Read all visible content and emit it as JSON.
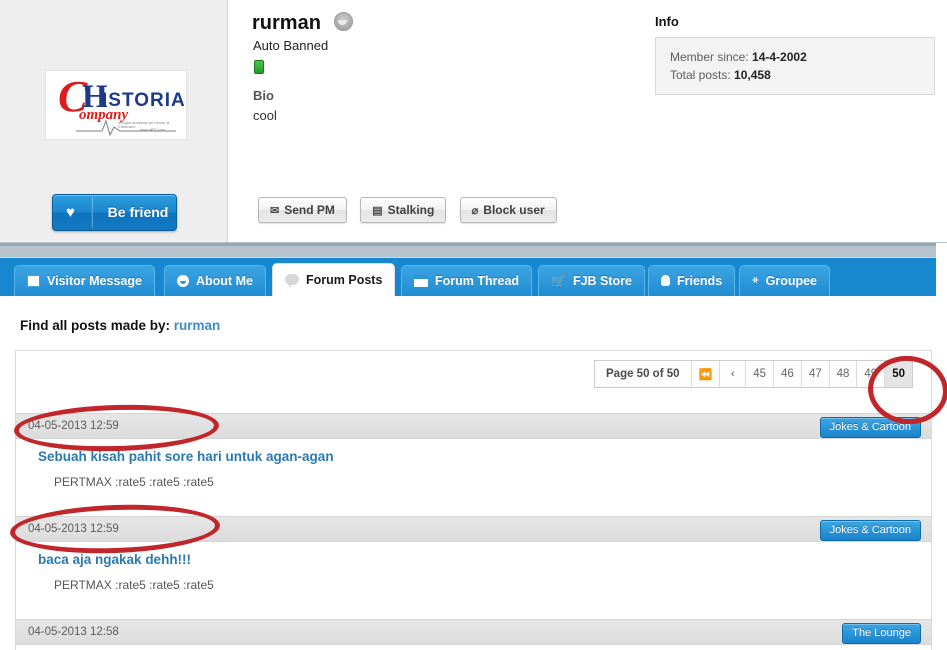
{
  "profile": {
    "logo": {
      "c": "C",
      "h": "H",
      "istoria": "ISTORIA",
      "ompany": "ompany",
      "tagline": "dengan suasana jar nenek di Cirbarano",
      "tagline2": "www.dkPC.com"
    },
    "befriend": {
      "label": "Be friend",
      "icon": "heart-icon",
      "glyph": "♥"
    },
    "username": "rurman",
    "status_icon": "banned-avatar-icon",
    "usertitle": "Auto Banned",
    "online_indicator": "online-status-chip",
    "bio_label": "Bio",
    "bio_text": "cool",
    "actions": [
      {
        "label": "Send PM",
        "icon": "envelope-icon",
        "glyph": "✉"
      },
      {
        "label": "Stalking",
        "icon": "bookmark-icon",
        "glyph": "▤"
      },
      {
        "label": "Block user",
        "icon": "block-icon",
        "glyph": "⌀"
      }
    ],
    "info": {
      "title": "Info",
      "member_since_label": "Member since:",
      "member_since_value": "14-4-2002",
      "total_posts_label": "Total posts:",
      "total_posts_value": "10,458"
    }
  },
  "tabs": [
    {
      "label": "Visitor Message",
      "icon": "document-icon",
      "active": false
    },
    {
      "label": "About Me",
      "icon": "person-icon",
      "active": false
    },
    {
      "label": "Forum Posts",
      "icon": "speech-bubble-icon",
      "active": true
    },
    {
      "label": "Forum Thread",
      "icon": "calendar-icon",
      "active": false
    },
    {
      "label": "FJB Store",
      "icon": "cart-icon",
      "active": false
    },
    {
      "label": "Friends",
      "icon": "bulb-icon",
      "active": false
    },
    {
      "label": "Groupee",
      "icon": "group-icon",
      "active": false
    }
  ],
  "content": {
    "find_all_label": "Find all posts made by:",
    "find_all_user": "rurman",
    "pager": {
      "info": "Page 50 of 50",
      "first_icon": "⏪",
      "prev_icon": "‹",
      "pages": [
        "45",
        "46",
        "47",
        "48",
        "49",
        "50"
      ],
      "current": "50"
    },
    "posts": [
      {
        "date": "04-05-2013 12:59",
        "forum": "Jokes & Cartoon",
        "title": "Sebuah kisah pahit sore hari untuk agan-agan",
        "snippet": "PERTMAX :rate5 :rate5 :rate5"
      },
      {
        "date": "04-05-2013 12:59",
        "forum": "Jokes & Cartoon",
        "title": "baca aja ngakak dehh!!!",
        "snippet": "PERTMAX :rate5 :rate5 :rate5"
      },
      {
        "date": "04-05-2013 12:58",
        "forum": "The Lounge",
        "title": "",
        "snippet": ""
      }
    ]
  },
  "annotations": {
    "circle_1": "highlight-post-date-1",
    "circle_2": "highlight-post-date-2",
    "circle_3": "highlight-current-page"
  },
  "colors": {
    "accent_blue": "#1787d0",
    "link_blue": "#2a7ab0",
    "annotation_red": "#c1262b",
    "panel_grey": "#eeeeee"
  }
}
